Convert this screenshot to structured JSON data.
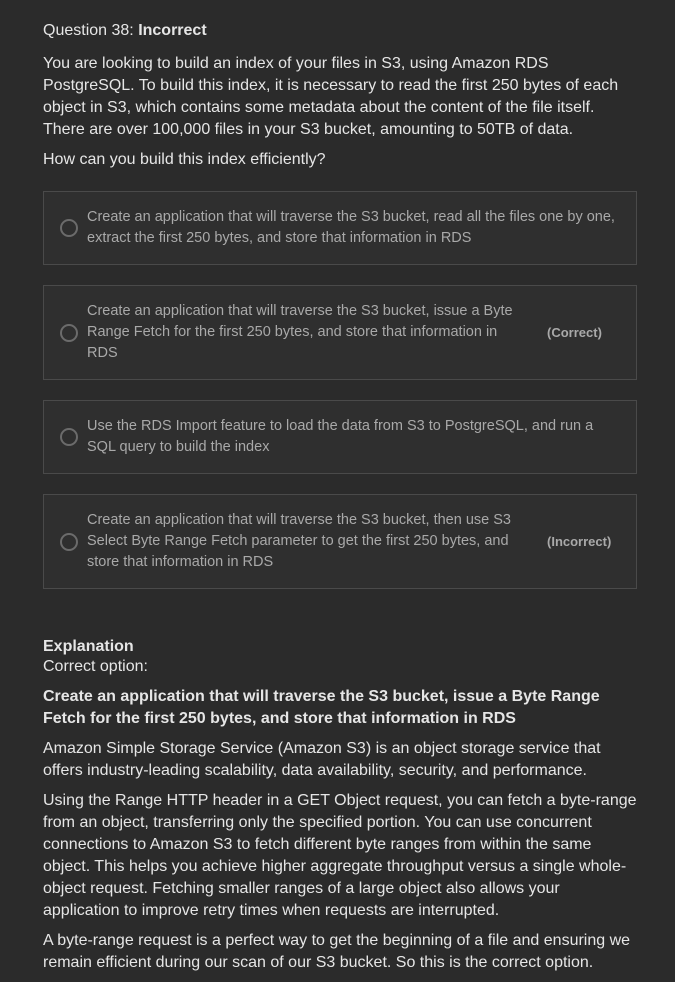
{
  "question": {
    "label": "Question 38:",
    "result": "Incorrect",
    "text": "You are looking to build an index of your files in S3, using Amazon RDS PostgreSQL. To build this index, it is necessary to read the first 250 bytes of each object in S3, which contains some metadata about the content of the file itself. There are over 100,000 files in your S3 bucket, amounting to 50TB of data.",
    "prompt": "How can you build this index efficiently?"
  },
  "options": [
    {
      "text": "Create an application that will traverse the S3 bucket, read all the files one by one, extract the first 250 bytes, and store that information in RDS",
      "status": ""
    },
    {
      "text": "Create an application that will traverse the S3 bucket, issue a Byte Range Fetch for the first 250 bytes, and store that information in RDS",
      "status": "(Correct)"
    },
    {
      "text": "Use the RDS Import feature to load the data from S3 to PostgreSQL, and run a SQL query to build the index",
      "status": ""
    },
    {
      "text": "Create an application that will traverse the S3 bucket, then use S3 Select Byte Range Fetch parameter to get the first 250 bytes, and store that information in RDS",
      "status": "(Incorrect)"
    }
  ],
  "explanation": {
    "title": "Explanation",
    "subtitle": "Correct option:",
    "answer": "Create an application that will traverse the S3 bucket, issue a Byte Range Fetch for the first 250 bytes, and store that information in RDS",
    "paragraphs": [
      "Amazon Simple Storage Service (Amazon S3) is an object storage service that offers industry-leading scalability, data availability, security, and performance.",
      "Using the Range HTTP header in a GET Object request, you can fetch a byte-range from an object, transferring only the specified portion. You can use concurrent connections to Amazon S3 to fetch different byte ranges from within the same object. This helps you achieve higher aggregate throughput versus a single whole-object request. Fetching smaller ranges of a large object also allows your application to improve retry times when requests are interrupted.",
      "A byte-range request is a perfect way to get the beginning of a file and ensuring we remain efficient during our scan of our S3 bucket. So this is the correct option."
    ]
  },
  "colors": {
    "background": "#2b2b2b",
    "text": "#e6e6e6",
    "muted": "#a9a9a9",
    "border": "#4a4a4a"
  }
}
